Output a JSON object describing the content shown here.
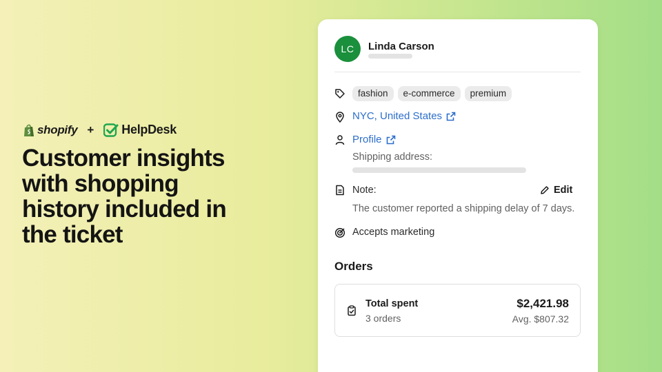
{
  "brand": {
    "shopify_name": "shopify",
    "plus": "+",
    "helpdesk_name": "HelpDesk",
    "shopify_color": "#5e8e3e",
    "helpdesk_color": "#1fa64f"
  },
  "headline": "Customer insights with shopping history included in the ticket",
  "customer": {
    "initials": "LC",
    "name": "Linda Carson",
    "avatar_color": "#1a8f3c",
    "tags": [
      "fashion",
      "e-commerce",
      "premium"
    ],
    "location": "NYC, United States",
    "profile_link": "Profile",
    "shipping_label": "Shipping address:",
    "note_label": "Note:",
    "edit_label": "Edit",
    "note_text": "The customer reported a shipping delay of 7 days.",
    "marketing": "Accepts marketing"
  },
  "orders": {
    "title": "Orders",
    "total_label": "Total spent",
    "count": "3 orders",
    "total_amount": "$2,421.98",
    "average": "Avg. $807.32"
  },
  "icons": {
    "tag": "tag-icon",
    "location": "location-pin-icon",
    "profile": "person-icon",
    "note": "document-icon",
    "marketing": "target-icon",
    "external": "external-link-icon",
    "edit": "pencil-icon",
    "orders": "clipboard-check-icon"
  },
  "colors": {
    "link": "#2c6ecb",
    "muted_text": "#616161"
  }
}
